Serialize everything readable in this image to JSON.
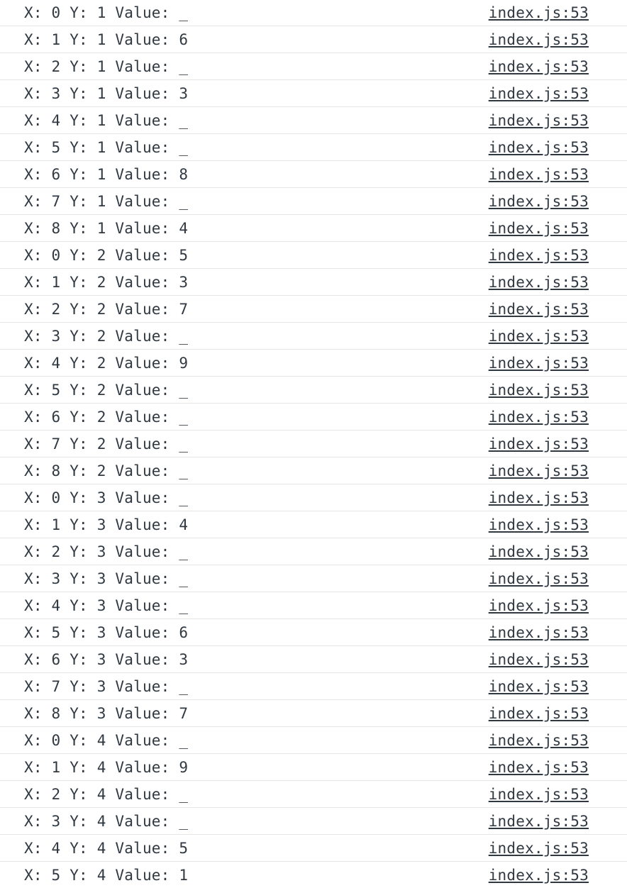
{
  "console": {
    "messages": [
      {
        "text": "X: 0 Y: 1 Value: _",
        "source": "index.js:53"
      },
      {
        "text": "X: 1 Y: 1 Value: 6",
        "source": "index.js:53"
      },
      {
        "text": "X: 2 Y: 1 Value: _",
        "source": "index.js:53"
      },
      {
        "text": "X: 3 Y: 1 Value: 3",
        "source": "index.js:53"
      },
      {
        "text": "X: 4 Y: 1 Value: _",
        "source": "index.js:53"
      },
      {
        "text": "X: 5 Y: 1 Value: _",
        "source": "index.js:53"
      },
      {
        "text": "X: 6 Y: 1 Value: 8",
        "source": "index.js:53"
      },
      {
        "text": "X: 7 Y: 1 Value: _",
        "source": "index.js:53"
      },
      {
        "text": "X: 8 Y: 1 Value: 4",
        "source": "index.js:53"
      },
      {
        "text": "X: 0 Y: 2 Value: 5",
        "source": "index.js:53"
      },
      {
        "text": "X: 1 Y: 2 Value: 3",
        "source": "index.js:53"
      },
      {
        "text": "X: 2 Y: 2 Value: 7",
        "source": "index.js:53"
      },
      {
        "text": "X: 3 Y: 2 Value: _",
        "source": "index.js:53"
      },
      {
        "text": "X: 4 Y: 2 Value: 9",
        "source": "index.js:53"
      },
      {
        "text": "X: 5 Y: 2 Value: _",
        "source": "index.js:53"
      },
      {
        "text": "X: 6 Y: 2 Value: _",
        "source": "index.js:53"
      },
      {
        "text": "X: 7 Y: 2 Value: _",
        "source": "index.js:53"
      },
      {
        "text": "X: 8 Y: 2 Value: _",
        "source": "index.js:53"
      },
      {
        "text": "X: 0 Y: 3 Value: _",
        "source": "index.js:53"
      },
      {
        "text": "X: 1 Y: 3 Value: 4",
        "source": "index.js:53"
      },
      {
        "text": "X: 2 Y: 3 Value: _",
        "source": "index.js:53"
      },
      {
        "text": "X: 3 Y: 3 Value: _",
        "source": "index.js:53"
      },
      {
        "text": "X: 4 Y: 3 Value: _",
        "source": "index.js:53"
      },
      {
        "text": "X: 5 Y: 3 Value: 6",
        "source": "index.js:53"
      },
      {
        "text": "X: 6 Y: 3 Value: 3",
        "source": "index.js:53"
      },
      {
        "text": "X: 7 Y: 3 Value: _",
        "source": "index.js:53"
      },
      {
        "text": "X: 8 Y: 3 Value: 7",
        "source": "index.js:53"
      },
      {
        "text": "X: 0 Y: 4 Value: _",
        "source": "index.js:53"
      },
      {
        "text": "X: 1 Y: 4 Value: 9",
        "source": "index.js:53"
      },
      {
        "text": "X: 2 Y: 4 Value: _",
        "source": "index.js:53"
      },
      {
        "text": "X: 3 Y: 4 Value: _",
        "source": "index.js:53"
      },
      {
        "text": "X: 4 Y: 4 Value: 5",
        "source": "index.js:53"
      },
      {
        "text": "X: 5 Y: 4 Value: 1",
        "source": "index.js:53"
      }
    ]
  }
}
